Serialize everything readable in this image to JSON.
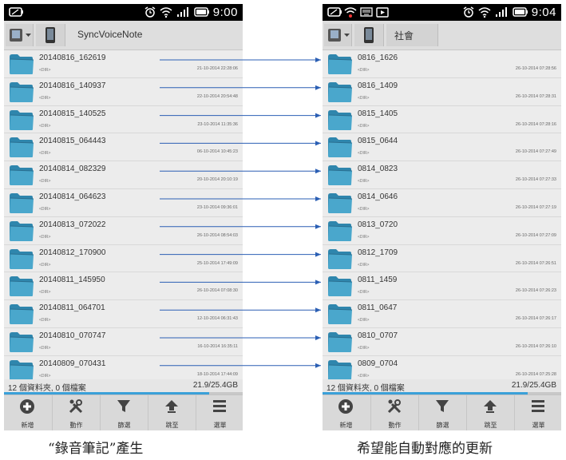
{
  "left": {
    "clock": "9:00",
    "path": "SyncVoiceNote",
    "folders": [
      {
        "name": "20140816_162619",
        "type": "<DIR>",
        "date": "21-10-2014 22:28:06"
      },
      {
        "name": "20140816_140937",
        "type": "<DIR>",
        "date": "22-10-2014 20:54:48"
      },
      {
        "name": "20140815_140525",
        "type": "<DIR>",
        "date": "23-10-2014 11:35:36"
      },
      {
        "name": "20140815_064443",
        "type": "<DIR>",
        "date": "06-10-2014 10:45:23"
      },
      {
        "name": "20140814_082329",
        "type": "<DIR>",
        "date": "20-10-2014 20:10:19"
      },
      {
        "name": "20140814_064623",
        "type": "<DIR>",
        "date": "23-10-2014 09:36:01"
      },
      {
        "name": "20140813_072022",
        "type": "<DIR>",
        "date": "26-10-2014 08:54:03"
      },
      {
        "name": "20140812_170900",
        "type": "<DIR>",
        "date": "25-10-2014 17:49:09"
      },
      {
        "name": "20140811_145950",
        "type": "<DIR>",
        "date": "26-10-2014 07:08:30"
      },
      {
        "name": "20140811_064701",
        "type": "<DIR>",
        "date": "12-10-2014 06:31:43"
      },
      {
        "name": "20140810_070747",
        "type": "<DIR>",
        "date": "16-10-2014 16:35:11"
      },
      {
        "name": "20140809_070431",
        "type": "<DIR>",
        "date": "18-10-2014 17:44:09"
      }
    ],
    "summary_left": "12 個資料夾, 0 個檔案",
    "summary_right": "21.9/25.4GB",
    "storage_used_fraction": 0.86,
    "caption": "“錄音筆記”產生"
  },
  "right": {
    "clock": "9:04",
    "path": "社會",
    "folders": [
      {
        "name": "0816_1626",
        "type": "<DIR>",
        "date": "26-10-2014 07:28:56"
      },
      {
        "name": "0816_1409",
        "type": "<DIR>",
        "date": "26-10-2014 07:28:31"
      },
      {
        "name": "0815_1405",
        "type": "<DIR>",
        "date": "26-10-2014 07:28:16"
      },
      {
        "name": "0815_0644",
        "type": "<DIR>",
        "date": "26-10-2014 07:27:49"
      },
      {
        "name": "0814_0823",
        "type": "<DIR>",
        "date": "26-10-2014 07:27:33"
      },
      {
        "name": "0814_0646",
        "type": "<DIR>",
        "date": "26-10-2014 07:27:19"
      },
      {
        "name": "0813_0720",
        "type": "<DIR>",
        "date": "26-10-2014 07:27:09"
      },
      {
        "name": "0812_1709",
        "type": "<DIR>",
        "date": "26-10-2014 07:26:51"
      },
      {
        "name": "0811_1459",
        "type": "<DIR>",
        "date": "26-10-2014 07:26:23"
      },
      {
        "name": "0811_0647",
        "type": "<DIR>",
        "date": "26-10-2014 07:26:17"
      },
      {
        "name": "0810_0707",
        "type": "<DIR>",
        "date": "26-10-2014 07:26:10"
      },
      {
        "name": "0809_0704",
        "type": "<DIR>",
        "date": "26-10-2014 07:25:28"
      }
    ],
    "summary_left": "12 個資料夾, 0 個檔案",
    "summary_right": "21.9/25.4GB",
    "storage_used_fraction": 0.86,
    "caption": "希望能自動對應的更新"
  },
  "toolbar": [
    {
      "label": "新增",
      "icon": "plus-circle-icon"
    },
    {
      "label": "動作",
      "icon": "tools-icon"
    },
    {
      "label": "篩選",
      "icon": "filter-icon"
    },
    {
      "label": "跳至",
      "icon": "upload-arrow-icon"
    },
    {
      "label": "選單",
      "icon": "menu-icon"
    }
  ],
  "colors": {
    "folder": "#4aa7cc",
    "arrow": "#2b5fb4",
    "progress": "#3aa0d8"
  }
}
